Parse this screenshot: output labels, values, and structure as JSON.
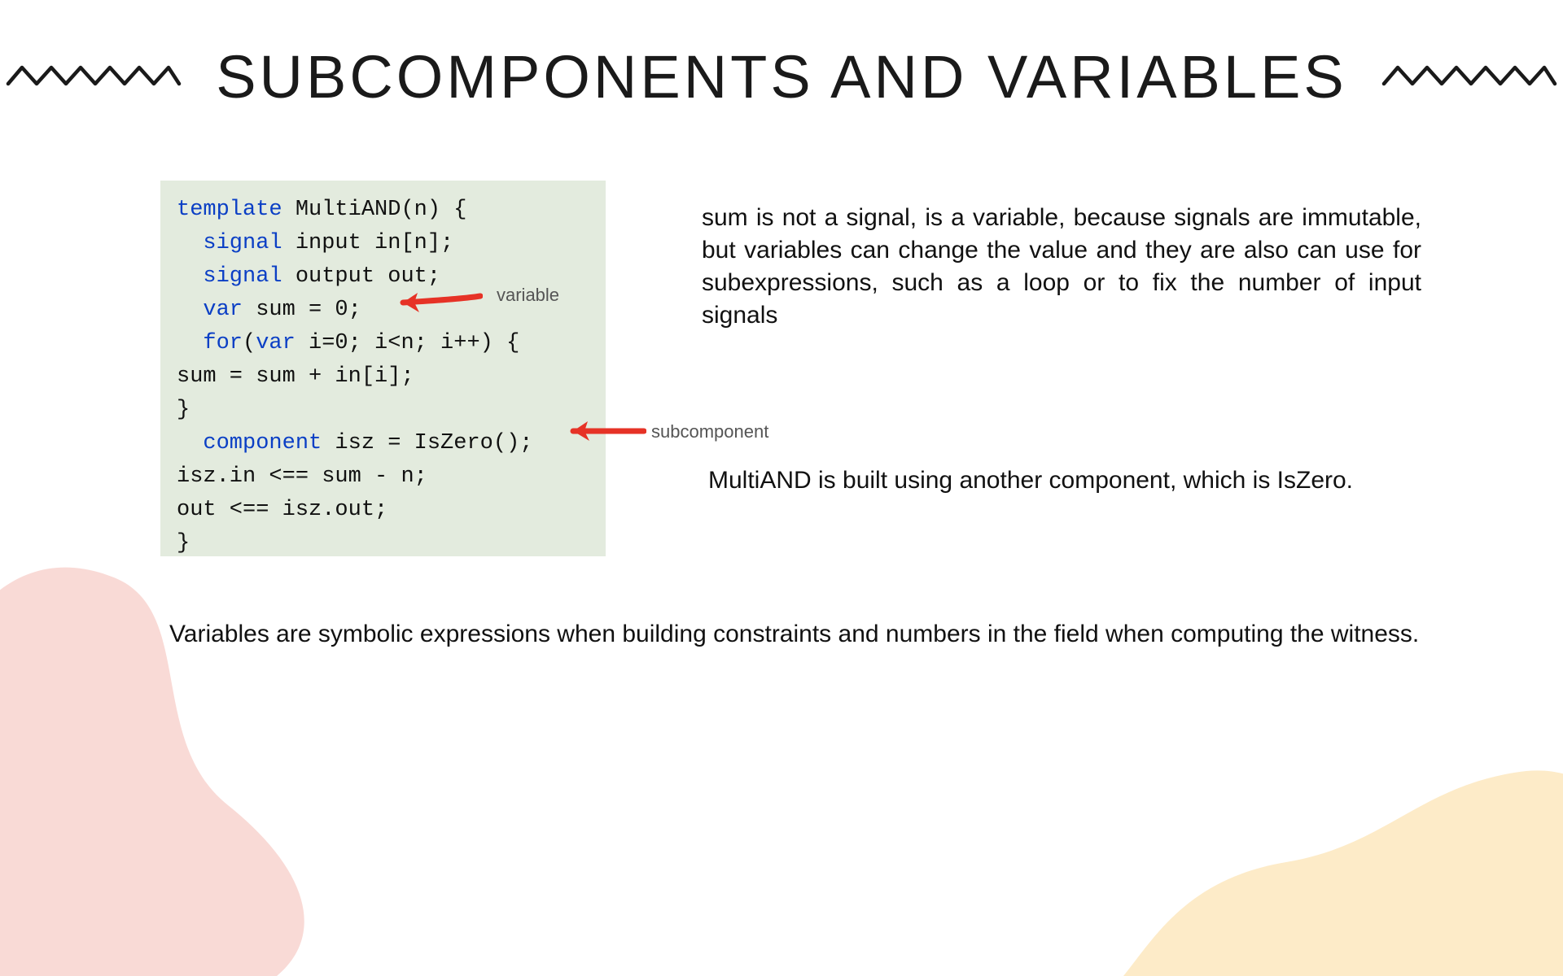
{
  "title": "SUBCOMPONENTS AND VARIABLES",
  "code": {
    "line1_kw": "template",
    "line1_rest": " MultiAND(n) {",
    "line2_kw": "signal",
    "line2_rest": " input in[n];",
    "line3_kw": "signal",
    "line3_rest": " output out;",
    "line4_kw": "var",
    "line4_rest": " sum = 0;",
    "line5_kw1": "for",
    "line5_mid": "(",
    "line5_kw2": "var",
    "line5_rest": " i=0; i<n; i++) {",
    "line6": "    sum = sum + in[i];",
    "line7": "  }",
    "line8_kw": "component",
    "line8_rest": " isz = IsZero();",
    "line9": "  isz.in <== sum - n;",
    "line10": "  out <== isz.out;",
    "line11": "}"
  },
  "annotations": {
    "variable_label": "variable",
    "subcomponent_label": "subcomponent"
  },
  "paragraphs": {
    "p1": "sum is not a signal, is a variable, because signals are immutable, but variables can change the value and they are also can use for subexpressions, such as a loop or to fix the number of input signals",
    "p2": "MultiAND is built using another component, which is IsZero.",
    "p3": "Variables are symbolic expressions when building constraints and numbers in the field when computing the witness."
  },
  "colors": {
    "keyword": "#0b3fc5",
    "code_bg": "#e3ebde",
    "arrow": "#e63226",
    "blob_left": "#f9dad6",
    "blob_right": "#fdebc8"
  }
}
